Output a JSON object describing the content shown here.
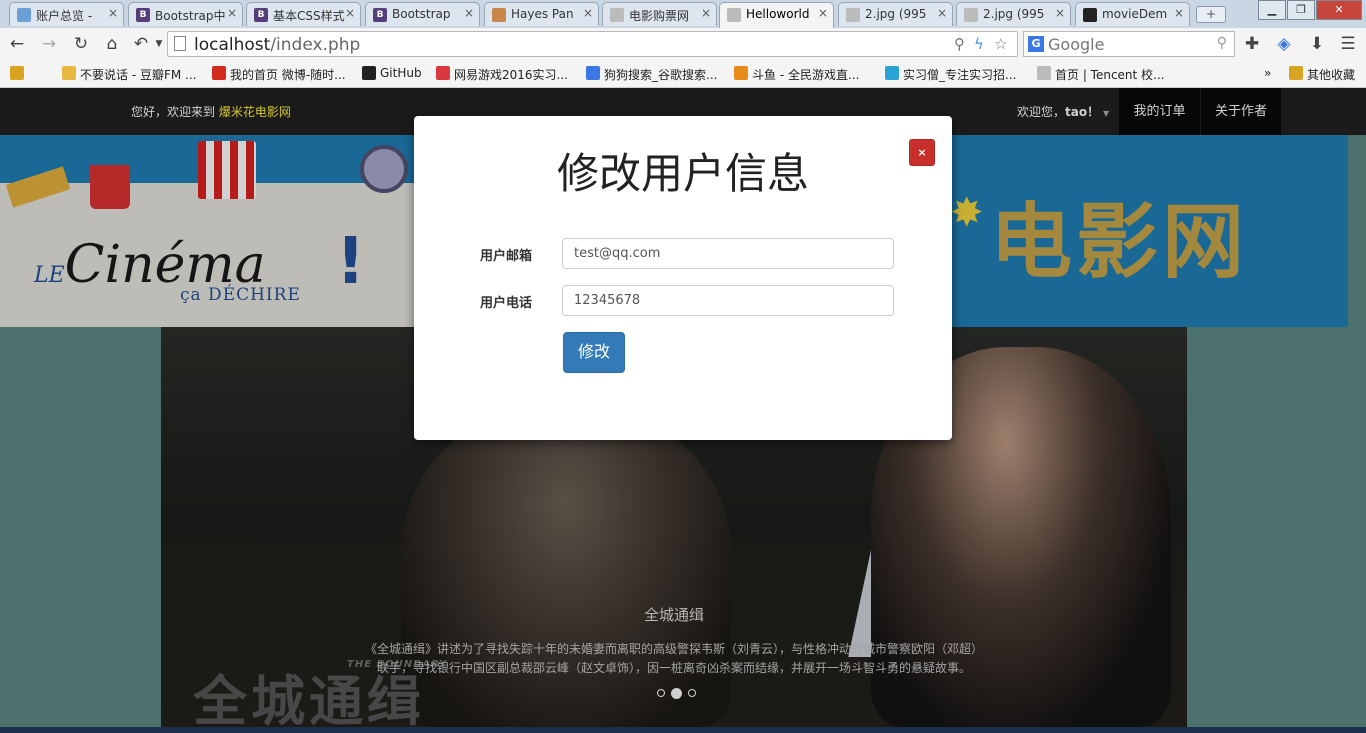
{
  "browser": {
    "tabs": [
      {
        "label": "账户总览 - ",
        "icon": "alipay-icon",
        "color": "#6aa0d8"
      },
      {
        "label": "Bootstrap中",
        "icon": "bootstrap-icon",
        "color": "#563d7c"
      },
      {
        "label": "基本CSS样式",
        "icon": "bootstrap-icon",
        "color": "#563d7c"
      },
      {
        "label": "Bootstrap ",
        "icon": "bootstrap-icon",
        "color": "#563d7c"
      },
      {
        "label": "Hayes Pan",
        "icon": "avatar-icon",
        "color": "#c8864b"
      },
      {
        "label": "电影购票网",
        "icon": "page-icon",
        "color": "#bbbbbb"
      },
      {
        "label": "Helloworld",
        "icon": "page-icon",
        "color": "#bbbbbb"
      },
      {
        "label": "2.jpg (995",
        "icon": "page-icon",
        "color": "#bbbbbb"
      },
      {
        "label": "2.jpg (995",
        "icon": "page-icon",
        "color": "#bbbbbb"
      },
      {
        "label": "movieDem",
        "icon": "github-icon",
        "color": "#222222"
      }
    ],
    "address": {
      "host": "localhost",
      "path": "/index.php"
    },
    "search": {
      "engine": "G",
      "placeholder": "Google"
    },
    "bookmarks": [
      {
        "label": "",
        "icon": "bookmark-folder-icon",
        "color": "#d9a520"
      },
      {
        "label": "不要说话 - 豆瓣FM ...",
        "icon": "douban-icon",
        "color": "#e7b73f"
      },
      {
        "label": "我的首页 微博-随时...",
        "icon": "weibo-icon",
        "color": "#d52b1e"
      },
      {
        "label": "GitHub",
        "icon": "github-icon",
        "color": "#222222"
      },
      {
        "label": "网易游戏2016实习...",
        "icon": "netease-icon",
        "color": "#d8393c"
      },
      {
        "label": "狗狗搜索_谷歌搜索...",
        "icon": "g-search-icon",
        "color": "#3b78e7"
      },
      {
        "label": "斗鱼 - 全民游戏直...",
        "icon": "douyu-icon",
        "color": "#e78b1a"
      },
      {
        "label": "实习僧_专注实习招...",
        "icon": "shixiseng-icon",
        "color": "#2aa3d4"
      },
      {
        "label": "首页 | Tencent 校...",
        "icon": "page-icon",
        "color": "#bbbbbb"
      }
    ],
    "more_bookmarks": "»",
    "other_bookmarks": "其他收藏"
  },
  "site": {
    "welcome_prefix": "您好，欢迎来到 ",
    "brand": "爆米花电影网",
    "user_greeting": "欢迎您，",
    "username": "tao！",
    "nav": [
      "我的订单",
      "关于作者"
    ],
    "banner": {
      "cinema_prefix": "LE",
      "cinema": "Cinéma",
      "sub": "ça DÉCHIRE",
      "title": "电影网"
    },
    "carousel": {
      "title": "全城通缉",
      "text": "《全城通缉》讲述为了寻找失踪十年的未婚妻而离职的高级警探韦斯（刘青云），与性格冲动的城市警察欧阳（邓超）联手，寻找银行中国区副总裁邵云峰（赵文卓饰），因一桩离奇凶杀案而结缘，并展开一场斗智斗勇的悬疑故事。",
      "film_logo": "全城通缉",
      "film_logo_en": "THE BOUNDARY",
      "slides": 3,
      "active_slide": 2
    }
  },
  "modal": {
    "title": "修改用户信息",
    "close": "×",
    "email_label": "用户邮箱",
    "email_value": "test@qq.com",
    "phone_label": "用户电话",
    "phone_value": "12345678",
    "submit": "修改"
  }
}
